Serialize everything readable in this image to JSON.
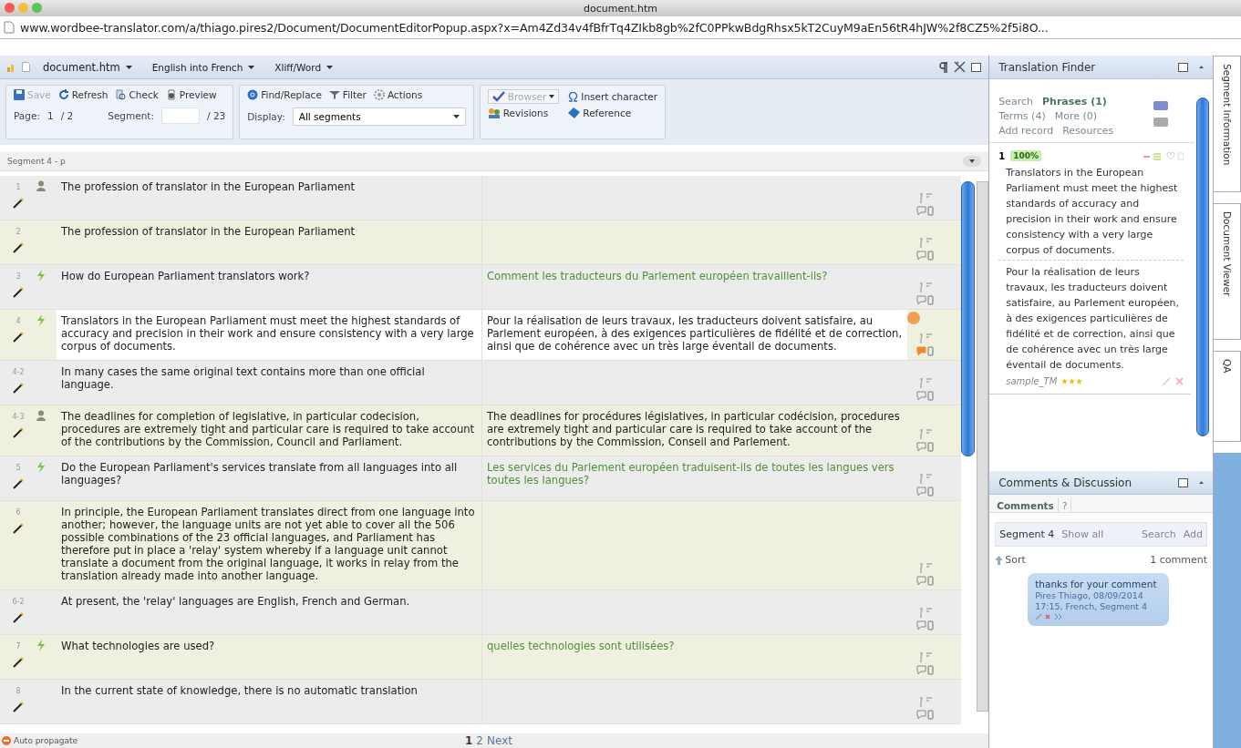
{
  "window": {
    "title": "document.htm",
    "url": "www.wordbee-translator.com/a/thiago.pires2/Document/DocumentEditorPopup.aspx?x=Am4Zd34v4fBfrTq4ZIkb8gb%2fC0PPkwBdgRhsx5kT2CuyM9aEn56tR4hJW%2f8CZ5%2f5i8O..."
  },
  "doc_bar": {
    "menus": [
      "document.htm",
      "English into French",
      "Xliff/Word"
    ]
  },
  "toolbar": {
    "actions": [
      {
        "label": "Save",
        "disabled": true
      },
      {
        "label": "Refresh",
        "disabled": false
      },
      {
        "label": "Check",
        "disabled": false
      },
      {
        "label": "Preview",
        "disabled": false
      }
    ],
    "page_label": "Page:",
    "page": "1",
    "page_total": "/ 2",
    "segment_label": "Segment:",
    "segment_total": "/ 23",
    "tools": [
      {
        "label": "Find/Replace"
      },
      {
        "label": "Filter"
      },
      {
        "label": "Actions"
      }
    ],
    "display_label": "Display:",
    "display_value": "All segments",
    "extras": [
      {
        "label": "Browser",
        "disabled": true,
        "dropdown": true
      },
      {
        "label": "Insert character",
        "disabled": false,
        "dropdown": false
      },
      {
        "label": "Revisions",
        "disabled": false,
        "dropdown": false
      },
      {
        "label": "Reference",
        "disabled": false,
        "dropdown": false
      }
    ]
  },
  "segment_bar": "Segment 4 - p",
  "segments": [
    {
      "num": "1",
      "kind": "human",
      "source": "The profession of translator in the European Parliament",
      "selected": false,
      "comment": false
    },
    {
      "num": "2",
      "kind": "plain",
      "source": "The profession of translator in the European Parliament",
      "selected": false,
      "comment": false
    },
    {
      "num": "3",
      "kind": "machine",
      "source": "How do European Parliament translators work?",
      "target": "Comment les traducteurs du Parlement européen travaillent-ils?",
      "suggested": true,
      "selected": false,
      "comment": false
    },
    {
      "num": "4",
      "kind": "machine",
      "source": "Translators in the European Parliament must meet the highest standards of accuracy and precision in their work and ensure consistency with a very large corpus of documents.",
      "target": "Pour la réalisation de leurs travaux, les traducteurs doivent satisfaire, au Parlement européen, à des exigences particulières de fidélité et de correction, ainsi que de cohérence avec un très large éventail de documents.",
      "suggested": false,
      "selected": true,
      "comment": true
    },
    {
      "num": "4-2",
      "kind": "plain",
      "source": "In many cases the same original text contains more than one official language.",
      "selected": false,
      "comment": false
    },
    {
      "num": "4-3",
      "kind": "human",
      "source": "The deadlines for completion of legislative, in particular codecision, procedures are extremely tight and particular care is required to take account of the contributions by the Commission, Council and Parliament.",
      "target": "The deadlines for procédures législatives, in particular codécision, procedures are extremely tight and particular care is required to take account of the contributions by the Commission, Conseil and Parlement.",
      "suggested": false,
      "selected": false,
      "comment": false
    },
    {
      "num": "5",
      "kind": "machine",
      "source": "Do the European Parliament's services translate from all languages into all languages?",
      "target": "Les services du Parlement européen traduisent-ils de toutes les langues vers toutes les langues?",
      "suggested": true,
      "selected": false,
      "comment": false
    },
    {
      "num": "6",
      "kind": "plain",
      "source": "In principle, the European Parliament translates direct from one language into another; however, the language units are not yet able to cover all the 506 possible combinations of the 23 official languages, and Parliament has therefore put in place a 'relay' system whereby if a language unit cannot translate a document from the original language, it works in relay from the translation already made into another language.",
      "selected": false,
      "comment": false
    },
    {
      "num": "6-2",
      "kind": "plain",
      "source": "At present, the 'relay' languages are English, French and German.",
      "selected": false,
      "comment": false
    },
    {
      "num": "7",
      "kind": "machine",
      "source": "What technologies are used?",
      "target": "quelles technologies sont utilisées?",
      "suggested": true,
      "selected": false,
      "comment": false
    },
    {
      "num": "8",
      "kind": "plain",
      "source": "In the current state of knowledge, there is no automatic translation",
      "selected": false,
      "comment": false
    }
  ],
  "footer": {
    "auto_propagate": "Auto propagate",
    "pages": [
      {
        "label": "1",
        "selected": true
      },
      {
        "label": "2",
        "selected": false
      },
      {
        "label": "Next",
        "selected": false
      }
    ]
  },
  "finder": {
    "title": "Translation Finder",
    "links": [
      {
        "label": "Search",
        "selected": false
      },
      {
        "label": "Phrases (1)",
        "selected": true
      },
      {
        "label": "Terms (4)",
        "selected": false
      },
      {
        "label": "More (0)",
        "selected": false
      },
      {
        "label": "Add record",
        "selected": false
      },
      {
        "label": "Resources",
        "selected": false
      }
    ],
    "result": {
      "num": "1",
      "match": "100%",
      "source": "Translators in the European Parliament must meet the highest standards of accuracy and precision in their work and ensure consistency with a very large corpus of documents.",
      "target": "Pour la réalisation de leurs travaux, les traducteurs doivent satisfaire, au Parlement européen, à des exigences particulières de fidélité et de correction, ainsi que de cohérence avec un très large éventail de documents.",
      "memory": "sample_TM",
      "stars": 3
    }
  },
  "comments": {
    "title": "Comments & Discussion",
    "tabs": [
      {
        "label": "Comments",
        "selected": true
      },
      {
        "label": "?",
        "selected": false
      }
    ],
    "scope": "Segment 4",
    "links": [
      "Show all",
      "Search",
      "Add"
    ],
    "sort": "Sort",
    "count": "1 comment",
    "items": [
      {
        "text": "thanks for your comment",
        "meta": "Pires Thiago, 08/09/2014 17:15, French, Segment 4"
      }
    ]
  },
  "side_tabs": [
    "Segment Information",
    "Document Viewer",
    "QA"
  ]
}
